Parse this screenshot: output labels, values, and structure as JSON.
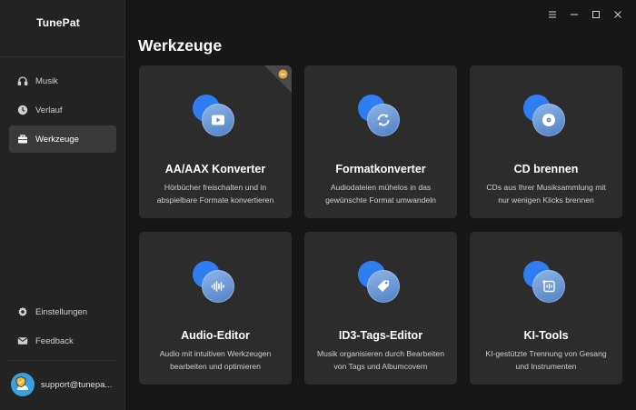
{
  "app": {
    "title": "TunePat"
  },
  "sidebar": {
    "items": [
      {
        "label": "Musik",
        "icon": "headphones-icon"
      },
      {
        "label": "Verlauf",
        "icon": "clock-icon"
      },
      {
        "label": "Werkzeuge",
        "icon": "toolbox-icon",
        "active": true
      }
    ],
    "bottom_items": [
      {
        "label": "Einstellungen",
        "icon": "gear-icon"
      },
      {
        "label": "Feedback",
        "icon": "mail-icon"
      }
    ],
    "user": {
      "email": "support@tunepa..."
    }
  },
  "main": {
    "title": "Werkzeuge",
    "cards": [
      {
        "title": "AA/AAX Konverter",
        "desc_line1": "Hörbücher freischalten und in",
        "desc_line2": "abspielbare Formate konvertieren",
        "icon": "play-icon",
        "badge": "crown-badge-icon"
      },
      {
        "title": "Formatkonverter",
        "desc_line1": "Audiodateien mühelos in das",
        "desc_line2": "gewünschte Format umwandeln",
        "icon": "refresh-icon"
      },
      {
        "title": "CD brennen",
        "desc_line1": "CDs aus Ihrer Musiksammlung mit",
        "desc_line2": "nur wenigen Klicks brennen",
        "icon": "disc-icon"
      },
      {
        "title": "Audio-Editor",
        "desc_line1": "Audio mit intuitiven Werkzeugen",
        "desc_line2": "bearbeiten und optimieren",
        "icon": "waveform-icon"
      },
      {
        "title": "ID3-Tags-Editor",
        "desc_line1": "Musik organisieren durch Bearbeiten",
        "desc_line2": "von Tags und Albumcovern",
        "icon": "tag-icon"
      },
      {
        "title": "KI-Tools",
        "desc_line1": "KI-gestützte Trennung von Gesang",
        "desc_line2": "und Instrumenten",
        "icon": "ai-icon"
      }
    ]
  },
  "colors": {
    "background": "#171717",
    "sidebar": "#232323",
    "card": "#2c2c2c",
    "accent": "#2f7df0"
  }
}
